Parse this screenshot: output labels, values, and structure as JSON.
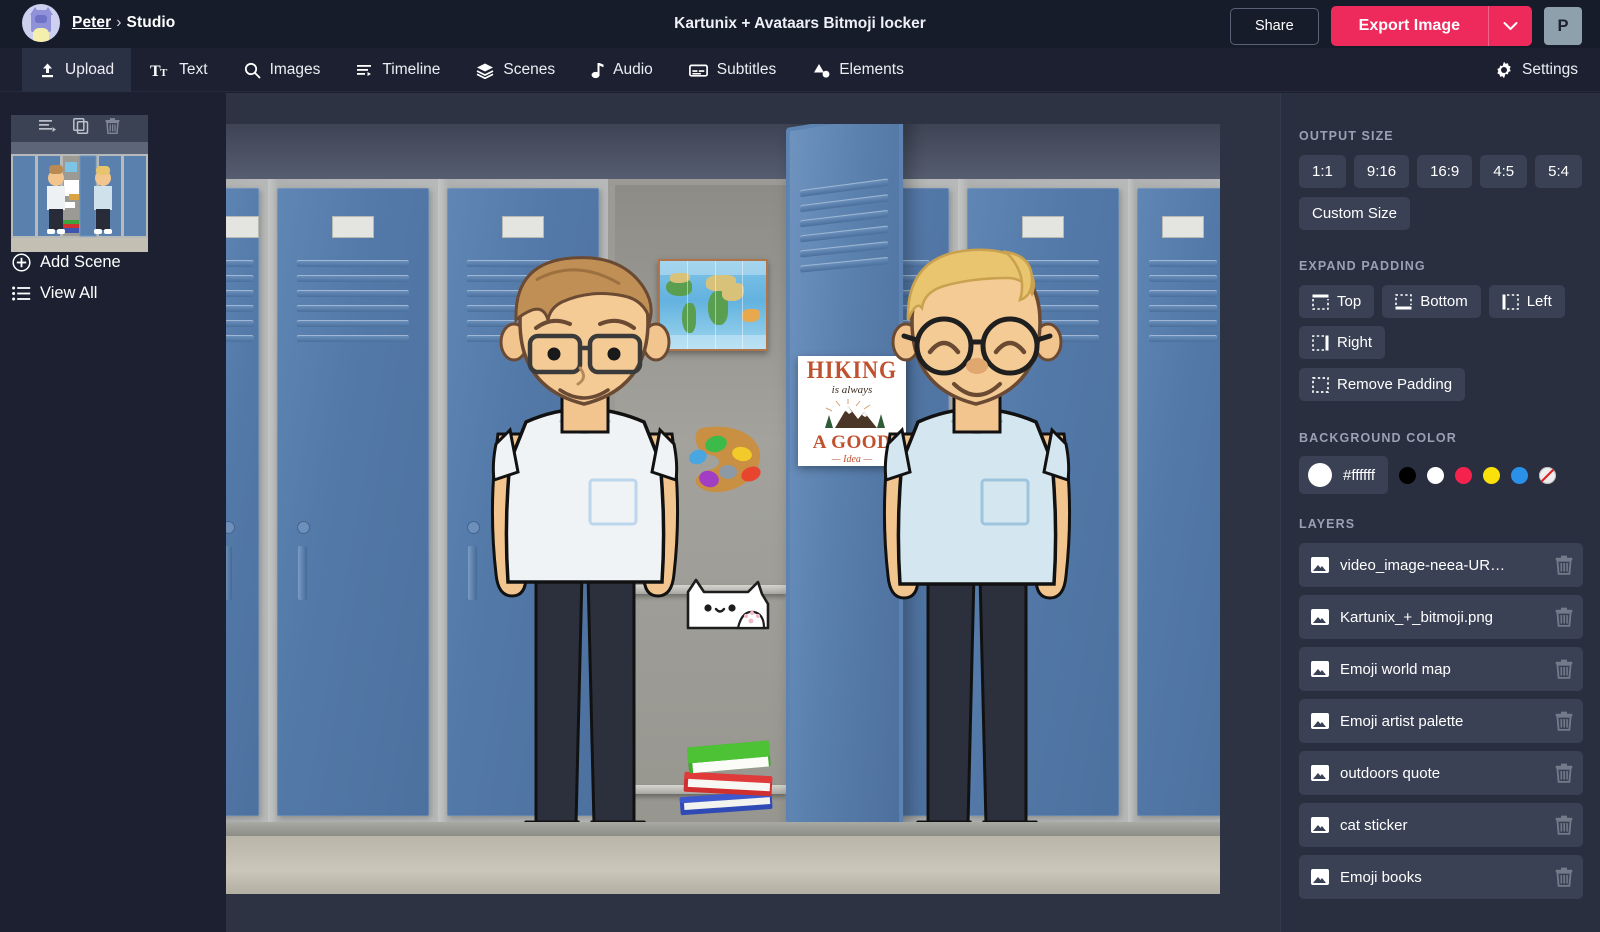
{
  "topbar": {
    "breadcrumb_user": "Peter",
    "breadcrumb_sep": "›",
    "breadcrumb_section": "Studio",
    "document_title": "Kartunix + Avataars Bitmoji locker",
    "share_label": "Share",
    "export_label": "Export Image",
    "export_caret_icon": "chevron-down-icon",
    "profile_initial": "P",
    "avatar_icon": "cat-avatar-icon"
  },
  "tools": [
    {
      "label": "Upload",
      "icon": "upload-icon",
      "active": true
    },
    {
      "label": "Text",
      "icon": "text-icon",
      "active": false
    },
    {
      "label": "Images",
      "icon": "search-icon",
      "active": false
    },
    {
      "label": "Timeline",
      "icon": "timeline-icon",
      "active": false
    },
    {
      "label": "Scenes",
      "icon": "layers-icon",
      "active": false
    },
    {
      "label": "Audio",
      "icon": "music-note-icon",
      "active": false
    },
    {
      "label": "Subtitles",
      "icon": "subtitles-icon",
      "active": false
    },
    {
      "label": "Elements",
      "icon": "shapes-icon",
      "active": false
    }
  ],
  "settings": {
    "label": "Settings",
    "icon": "gear-icon"
  },
  "left_panel": {
    "scene_tools": [
      {
        "icon": "reorder-icon"
      },
      {
        "icon": "duplicate-icon"
      },
      {
        "icon": "trash-icon"
      }
    ],
    "add_scene_label": "Add Scene",
    "add_scene_icon": "plus-circle-icon",
    "view_all_label": "View All",
    "view_all_icon": "list-icon"
  },
  "right_panel": {
    "output_size": {
      "label": "OUTPUT SIZE",
      "ratios": [
        "1:1",
        "9:16",
        "16:9",
        "4:5",
        "5:4"
      ],
      "custom_label": "Custom Size"
    },
    "expand_padding": {
      "label": "EXPAND PADDING",
      "buttons": [
        {
          "label": "Top",
          "icon": "pad-top-icon"
        },
        {
          "label": "Bottom",
          "icon": "pad-bottom-icon"
        },
        {
          "label": "Left",
          "icon": "pad-left-icon"
        },
        {
          "label": "Right",
          "icon": "pad-right-icon"
        },
        {
          "label": "Remove Padding",
          "icon": "pad-remove-icon"
        }
      ]
    },
    "background_color": {
      "label": "BACKGROUND COLOR",
      "current_hex": "#ffffff",
      "swatches": [
        "#000000",
        "#ffffff",
        "#f5224e",
        "#fbe10a",
        "#2a90e8",
        "transparent"
      ]
    },
    "layers": {
      "label": "LAYERS",
      "items": [
        {
          "name": "video_image-neea-UR…",
          "icon": "image-icon",
          "delete_icon": "trash-icon"
        },
        {
          "name": "Kartunix_+_bitmoji.png",
          "icon": "image-icon",
          "delete_icon": "trash-icon"
        },
        {
          "name": "Emoji world map",
          "icon": "image-icon",
          "delete_icon": "trash-icon"
        },
        {
          "name": "Emoji artist palette",
          "icon": "image-icon",
          "delete_icon": "trash-icon"
        },
        {
          "name": "outdoors quote",
          "icon": "image-icon",
          "delete_icon": "trash-icon"
        },
        {
          "name": "cat sticker",
          "icon": "image-icon",
          "delete_icon": "trash-icon"
        },
        {
          "name": "Emoji books",
          "icon": "image-icon",
          "delete_icon": "trash-icon"
        }
      ]
    }
  },
  "canvas": {
    "scene_description": "Two cartoon avatar boys standing in front of a row of blue school lockers, one locker open showing shelves",
    "poster": {
      "line1": "HIKING",
      "line2": "is always",
      "line3": "A GOOD",
      "line4": "— Idea —"
    },
    "props": [
      "world map",
      "artist palette",
      "cat sticker",
      "book stack"
    ]
  },
  "colors": {
    "accent_export": "#ee2a5c",
    "topbar_bg": "#171c2b",
    "panel_bg": "#2a2f40",
    "app_bg": "#1c2030",
    "chip_bg": "#3a4154",
    "locker_blue": "#5379a8"
  }
}
